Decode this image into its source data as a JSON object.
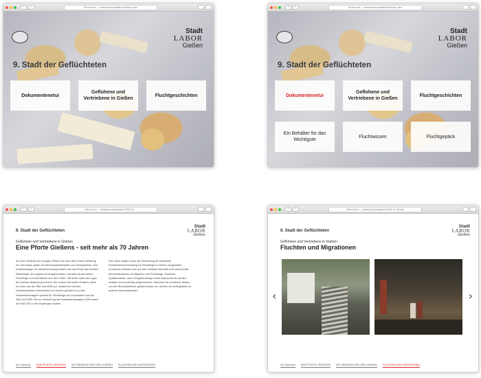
{
  "browser": {
    "address_1": "Nicht sicher — webbank.de/stadtlabor/09/index.html",
    "address_2": "Nicht sicher — webbank.de/stadtlabor/09/index.html",
    "address_3": "Nicht sicher — webbank.de/stadtlabor/09/06-01-...",
    "address_4": "Nicht sicher — webbank.de/stadtlabor/09/06-02-06.html",
    "back_glyph": "‹",
    "forward_glyph": "›"
  },
  "logo": {
    "line1": "Stadt",
    "line2": "LABOR",
    "line3": "Gießen"
  },
  "overview": {
    "title": "9. Stadt der Geflüchteten",
    "tiles_row1": [
      "Dokumentenetui",
      "Geflohene und Vertriebene in Gießen",
      "Fluchtgeschichten"
    ],
    "tiles_row2": [
      "Ein Behälter für das Wichtigste",
      "Fluchtwissen",
      "Fluchtgepäck"
    ]
  },
  "article1": {
    "section": "9. Stadt der Geflüchteten",
    "subtitle": "Geflohene und Vertriebene in Gießen",
    "headline": "Eine Pforte Gießens - seit mehr als 70 Jahren",
    "col1": "Auf dem Gelände der heutigen HEAE war nach dem Ersten Weltkrieg ein Viehmarkt, später ein Wehrmachtsstellplatz von Schaustellern. Das Aufnahmelager am Meisenbornweg besteht seit dem Ende des Zweiten Weltkrieges. Es begann mit Ausgebombten und bald darauf kamen Flüchtlinge und Vertriebene aus dem Osten. Mit ihnen hatte das Lager die höchste Bedeutung erreicht. Die meiste Zeit seiner Existenz nahm es Leute aus der SBZ und DDR auf. Zusammen mit den Aufnahmestellen Marienfelde und Uelzen gehörte es zu den Notaufnahmelagern speziell für Flüchtlinge und Zuwanderer aus der SBZ und DDR. Bis zur Schließung des Notaufnahmelagers 1990 waren dort 960 000 Leute empfangen worden.",
    "col2": "Drei Jahre später wurde die Einrichtung als Hessische Erstaufnahmeeinrichtung für Flüchtlinge in Gießen neugestaltet, inzwischen befindet sich auf dem Gelände ebenfalls eine Außenstelle des Bundesamtes für Migration und Flüchtlinge. Zunächst Spätaussiedler, dann Kriegsflüchtlinge sowie Asylsuchende werden seitdem dort kurzfristig aufgenommen. Nachdem ihr rechtlicher Status von der Bundesbehörde geklärt worden ist, werden sie weitergeleitet zu anderen Aufenthaltsorten."
  },
  "article2": {
    "section": "9. Stadt der Geflüchteten",
    "subtitle": "Geflohene und Vertriebene in Gießen",
    "headline": "Fluchten und Migrationen"
  },
  "footer_nav": {
    "items": [
      "Zur Übersicht",
      "EINE PFORTE GIESSENS",
      "DIE ORDNUNG DER GEFLOHENEN",
      "FLUCHTEN UND MIGRATIONEN"
    ],
    "separator": "|"
  },
  "colors": {
    "accent": "#d81f26"
  },
  "icons": {
    "prev": "‹",
    "next": "›"
  }
}
